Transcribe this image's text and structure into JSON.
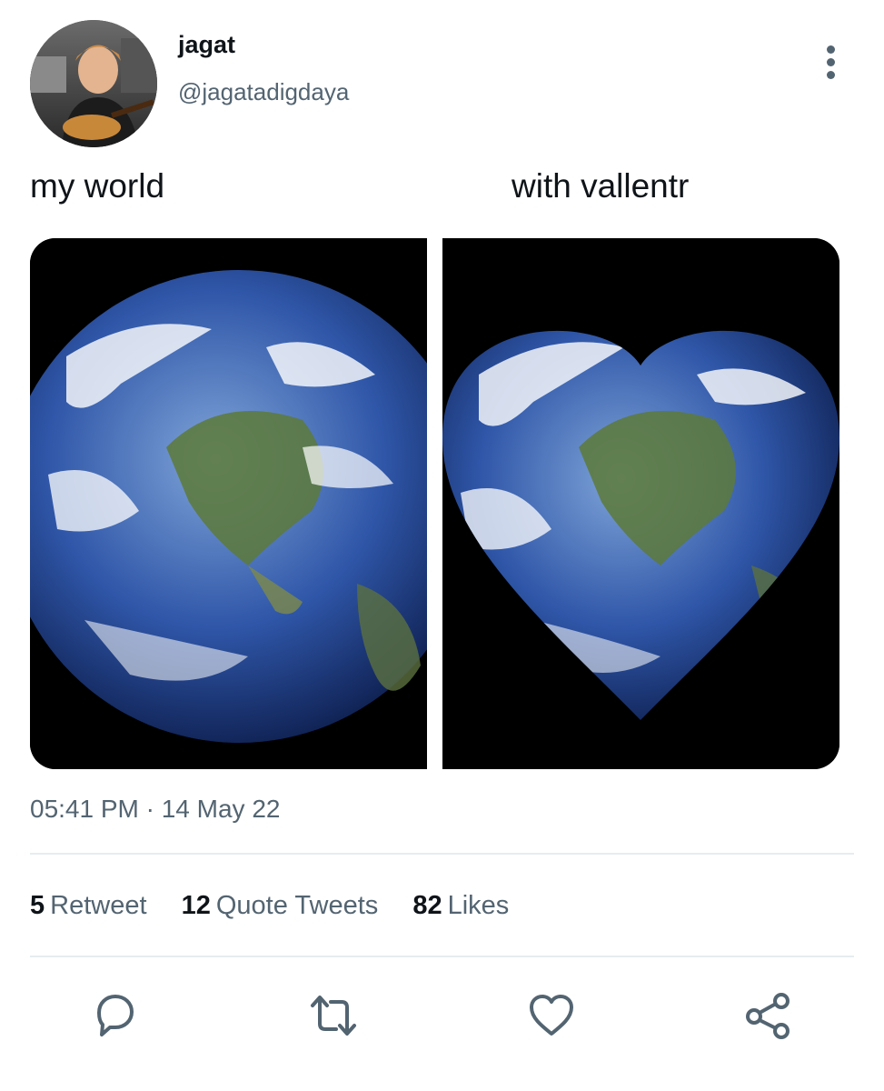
{
  "author": {
    "name": "jagat",
    "handle": "@jagatadigdaya"
  },
  "tweet": {
    "caption_left": "my world",
    "caption_right": "with vallentr",
    "timestamp": "05:41 PM · 14 May 22"
  },
  "stats": {
    "retweets_count": "5",
    "retweets_label": "Retweet",
    "quotes_count": "12",
    "quotes_label": "Quote Tweets",
    "likes_count": "82",
    "likes_label": "Likes"
  },
  "icons": {
    "more": "more-vertical-icon",
    "reply": "reply-icon",
    "retweet": "retweet-icon",
    "like": "heart-icon",
    "share": "share-icon"
  },
  "colors": {
    "text_primary": "#0f1419",
    "text_secondary": "#536471",
    "divider": "#e6ecf0"
  }
}
